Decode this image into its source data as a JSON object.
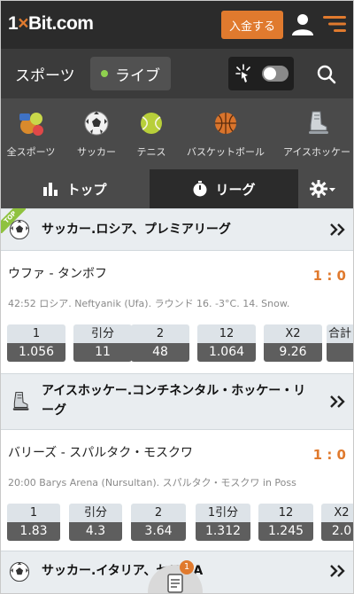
{
  "header": {
    "logo_prefix": "1",
    "logo_x": "×",
    "logo_suffix": "Bit.com",
    "deposit_label": "入金する"
  },
  "sportsbar": {
    "title": "スポーツ",
    "live_label": "ライブ",
    "live_toggle_on": false
  },
  "categories": [
    {
      "label": "全スポーツ",
      "icon": "all-sports-icon"
    },
    {
      "label": "サッカー",
      "icon": "soccer-ball-icon"
    },
    {
      "label": "テニス",
      "icon": "tennis-ball-icon"
    },
    {
      "label": "バスケットボール",
      "icon": "basketball-icon"
    },
    {
      "label": "アイスホッケー",
      "icon": "ice-skate-icon"
    }
  ],
  "tabs": {
    "top": "トップ",
    "league": "リーグ"
  },
  "ribbon": "TOP",
  "leagues": [
    {
      "name": "サッカー.ロシア、プレミアリーグ",
      "icon": "soccer-ball-icon",
      "match": {
        "teams": "ウファ - タンボフ",
        "score": "1 : 0",
        "info": "42:52  ロシア. Neftyanik (Ufa). ラウンド  16. -3°C. 14. Snow.",
        "odds": [
          {
            "label": "1",
            "value": "1.056"
          },
          {
            "label": "引分",
            "value": "11"
          },
          {
            "label": "2",
            "value": "48"
          },
          {
            "label": "12",
            "value": "1.064"
          },
          {
            "label": "X2",
            "value": "9.26"
          },
          {
            "label": "合計",
            "value": ""
          }
        ]
      }
    },
    {
      "name": "アイスホッケー.コンチネンタル・ホッケー・リーグ",
      "icon": "ice-skate-icon",
      "match": {
        "teams": "バリーズ - スパルタク・モスクワ",
        "score": "1 : 0",
        "info": "20:00  Barys Arena (Nursultan). スパルタク・モスクワ in Poss",
        "odds": [
          {
            "label": "1",
            "value": "1.83"
          },
          {
            "label": "引分",
            "value": "4.3"
          },
          {
            "label": "2",
            "value": "3.64"
          },
          {
            "label": "1引分",
            "value": "1.312"
          },
          {
            "label": "12",
            "value": "1.245"
          },
          {
            "label": "X2",
            "value": "2.0"
          }
        ]
      }
    },
    {
      "name": "サッカー.イタリア、セリエA",
      "icon": "soccer-ball-icon"
    }
  ],
  "coupon_count": "1",
  "colors": {
    "accent": "#e07a2e",
    "header": "#2b2b2b",
    "live_dot": "#8fd14f"
  }
}
